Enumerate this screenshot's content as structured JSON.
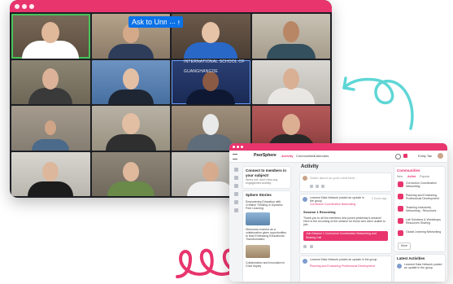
{
  "colors": {
    "brand": "#e8356d",
    "zoom_blue": "#0b72e7",
    "active_speaker": "#49c35a",
    "arrow": "#5fd6d6"
  },
  "call": {
    "unmute_label": "Ask to Unmute",
    "more_label": "...",
    "banner_text": "INTERNATIONAL SCHOOL OF GUANGHANGDE"
  },
  "app": {
    "brand": "PeerSphere",
    "tabs": [
      "Activity",
      "Communities",
      "Calendars"
    ],
    "user_name": "Emily Tan",
    "left": {
      "connect_title": "Connect to members in your subject!",
      "connect_sub": "Worry not; don't miss any engagement activity.",
      "stories_title": "Sphere Stories",
      "story1": "Empowering Education with Creative Thinking in Dynamic Peer Learning",
      "story2": "Dinesoms moment as a collaboration gives opportunities to lead Embracing Educational Transformation",
      "story3": "Collaboration and Innovation in Grad Inquiry"
    },
    "center": {
      "heading": "Activity",
      "post_placeholder": "Share about on your mind here...",
      "post_author": "Learned Data Network posted an update in the group",
      "post_group": "Curriculum Coordination Networking",
      "post_time": "2 hours ago",
      "post_tag": "Session 1 Recording",
      "post_text": "Thank you to all the members who joined yesterday's session! Here is the recording of the session for those who were unable to join.",
      "post_button": "Join Session 1 Curriculum Coordination Networking and Sharing Call",
      "post2_author": "Learned Data Network posted an update in the group",
      "post2_group": "Planning and Enhancing Professional Development"
    },
    "right": {
      "title": "Communities",
      "filters": [
        "New",
        "Active",
        "Popular"
      ],
      "items": [
        "Curriculum Coordination Networking",
        "Planning and Enhancing Professional Development",
        "Teaching Inclusively Networking - Resources",
        "Lab Solutions & Workshops Resources Sharing",
        "Global Learning Networking"
      ],
      "more_label": "More",
      "latest_title": "Latest Activities",
      "latest_item": "Learned Data Network posted an update in the group"
    }
  }
}
